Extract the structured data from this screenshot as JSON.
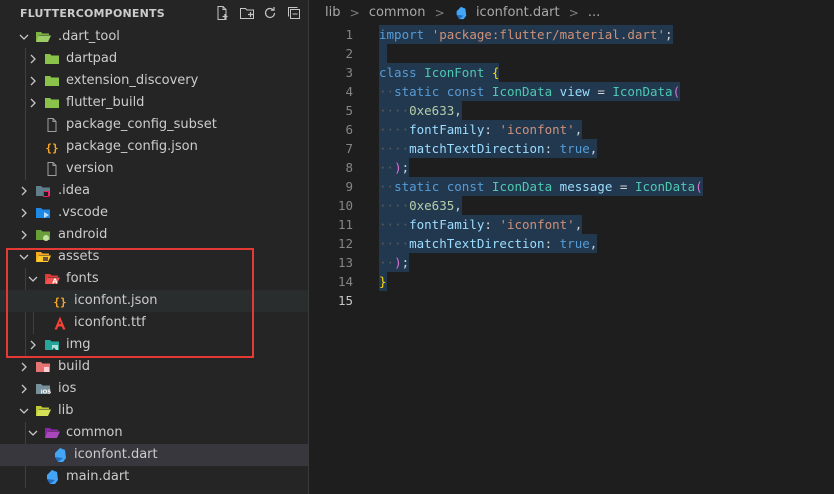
{
  "explorer": {
    "title": "FLUTTERCOMPONENTS",
    "actions": [
      "new-file-icon",
      "new-folder-icon",
      "refresh-icon",
      "collapse-all-icon"
    ]
  },
  "tree": [
    {
      "label": ".dart_tool",
      "icon": "folder-open-icon",
      "expanded": true,
      "depth": 1
    },
    {
      "label": "dartpad",
      "icon": "folder-icon",
      "expanded": false,
      "depth": 2
    },
    {
      "label": "extension_discovery",
      "icon": "folder-icon",
      "expanded": false,
      "depth": 2
    },
    {
      "label": "flutter_build",
      "icon": "folder-icon",
      "expanded": false,
      "depth": 2
    },
    {
      "label": "package_config_subset",
      "icon": "file-icon",
      "depth": 2
    },
    {
      "label": "package_config.json",
      "icon": "json-icon",
      "depth": 2
    },
    {
      "label": "version",
      "icon": "file-icon",
      "depth": 2
    },
    {
      "label": ".idea",
      "icon": "idea-folder-icon",
      "expanded": false,
      "depth": 1
    },
    {
      "label": ".vscode",
      "icon": "vscode-folder-icon",
      "expanded": false,
      "depth": 1
    },
    {
      "label": "android",
      "icon": "android-folder-icon",
      "expanded": false,
      "depth": 1
    },
    {
      "label": "assets",
      "icon": "assets-folder-icon",
      "expanded": true,
      "depth": 1
    },
    {
      "label": "fonts",
      "icon": "fonts-folder-icon",
      "expanded": true,
      "depth": 2
    },
    {
      "label": "iconfont.json",
      "icon": "json-icon",
      "depth": 3
    },
    {
      "label": "iconfont.ttf",
      "icon": "font-file-icon",
      "depth": 3
    },
    {
      "label": "img",
      "icon": "images-folder-icon",
      "expanded": false,
      "depth": 2
    },
    {
      "label": "build",
      "icon": "build-folder-icon",
      "expanded": false,
      "depth": 1
    },
    {
      "label": "ios",
      "icon": "ios-folder-icon",
      "expanded": false,
      "depth": 1
    },
    {
      "label": "lib",
      "icon": "lib-folder-icon",
      "expanded": true,
      "depth": 1
    },
    {
      "label": "common",
      "icon": "common-folder-icon",
      "expanded": true,
      "depth": 2
    },
    {
      "label": "iconfont.dart",
      "icon": "dart-file-icon",
      "depth": 3,
      "selected": true
    },
    {
      "label": "main.dart",
      "icon": "dart-file-icon",
      "depth": 2
    }
  ],
  "breadcrumb": {
    "items": [
      "lib",
      "common",
      "iconfont.dart",
      "..."
    ],
    "separator": ">"
  },
  "editor": {
    "line_numbers": [
      "1",
      "2",
      "3",
      "4",
      "5",
      "6",
      "7",
      "8",
      "9",
      "10",
      "11",
      "12",
      "13",
      "14",
      "15"
    ],
    "current_line": "15",
    "code": [
      [
        [
          "kw",
          "import"
        ],
        [
          "ws",
          " "
        ],
        [
          "str",
          "'package:flutter/material.dart'"
        ],
        [
          "pun",
          ";"
        ]
      ],
      [],
      [
        [
          "kw",
          "class"
        ],
        [
          "ws",
          " "
        ],
        [
          "cls",
          "IconFont"
        ],
        [
          "ws",
          " "
        ],
        [
          "brk1",
          "{"
        ]
      ],
      [
        [
          "ws",
          "··"
        ],
        [
          "kw",
          "static"
        ],
        [
          "ws",
          " "
        ],
        [
          "kw",
          "const"
        ],
        [
          "ws",
          " "
        ],
        [
          "cls",
          "IconData"
        ],
        [
          "ws",
          " "
        ],
        [
          "prop",
          "view"
        ],
        [
          "ws",
          " "
        ],
        [
          "pun",
          "="
        ],
        [
          "ws",
          " "
        ],
        [
          "cls",
          "IconData"
        ],
        [
          "brk2",
          "("
        ]
      ],
      [
        [
          "ws",
          "····"
        ],
        [
          "num",
          "0xe633"
        ],
        [
          "pun",
          ","
        ]
      ],
      [
        [
          "ws",
          "····"
        ],
        [
          "prop",
          "fontFamily"
        ],
        [
          "pun",
          ":"
        ],
        [
          "ws",
          " "
        ],
        [
          "str",
          "'iconfont'"
        ],
        [
          "pun",
          ","
        ]
      ],
      [
        [
          "ws",
          "····"
        ],
        [
          "prop",
          "matchTextDirection"
        ],
        [
          "pun",
          ":"
        ],
        [
          "ws",
          " "
        ],
        [
          "kw",
          "true"
        ],
        [
          "pun",
          ","
        ]
      ],
      [
        [
          "ws",
          "··"
        ],
        [
          "brk2",
          ")"
        ],
        [
          "pun",
          ";"
        ]
      ],
      [
        [
          "ws",
          "··"
        ],
        [
          "kw",
          "static"
        ],
        [
          "ws",
          " "
        ],
        [
          "kw",
          "const"
        ],
        [
          "ws",
          " "
        ],
        [
          "cls",
          "IconData"
        ],
        [
          "ws",
          " "
        ],
        [
          "prop",
          "message"
        ],
        [
          "ws",
          " "
        ],
        [
          "pun",
          "="
        ],
        [
          "ws",
          " "
        ],
        [
          "cls",
          "IconData"
        ],
        [
          "brk2",
          "("
        ]
      ],
      [
        [
          "ws",
          "····"
        ],
        [
          "num",
          "0xe635"
        ],
        [
          "pun",
          ","
        ]
      ],
      [
        [
          "ws",
          "····"
        ],
        [
          "prop",
          "fontFamily"
        ],
        [
          "pun",
          ":"
        ],
        [
          "ws",
          " "
        ],
        [
          "str",
          "'iconfont'"
        ],
        [
          "pun",
          ","
        ]
      ],
      [
        [
          "ws",
          "····"
        ],
        [
          "prop",
          "matchTextDirection"
        ],
        [
          "pun",
          ":"
        ],
        [
          "ws",
          " "
        ],
        [
          "kw",
          "true"
        ],
        [
          "pun",
          ","
        ]
      ],
      [
        [
          "ws",
          "··"
        ],
        [
          "brk2",
          ")"
        ],
        [
          "pun",
          ";"
        ]
      ],
      [
        [
          "brk1",
          "}"
        ]
      ],
      []
    ]
  },
  "colors": {
    "highlight_border": "#e53935",
    "selection": "#264f78",
    "dart_blue": "#42a5f5"
  }
}
